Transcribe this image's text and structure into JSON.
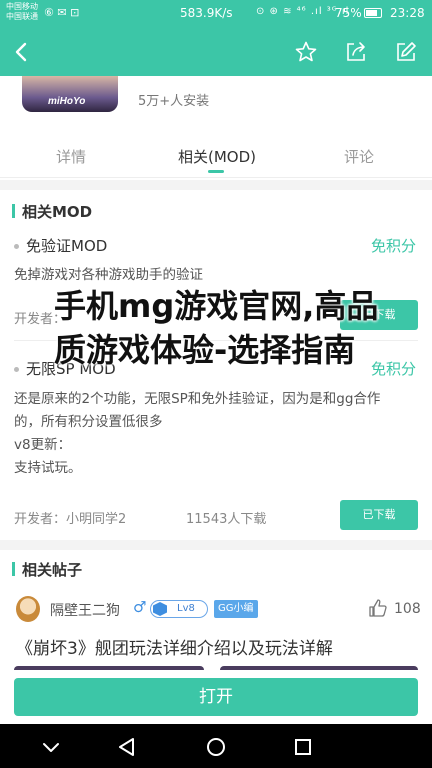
{
  "status_bar": {
    "carrier_line1": "中国移动",
    "carrier_line2": "中国联通",
    "left_icons": "⑥ ✉ ⊡",
    "net_speed": "583.9K/s",
    "right_icons": "⊙ ⊛ ≋ ⁴⁶ .ıl ³ᴳ.ıl",
    "battery": "75%",
    "time": "23:28"
  },
  "app_bar": {
    "back_icon": "back-arrow-icon",
    "actions": [
      "star-icon",
      "share-icon",
      "edit-icon"
    ]
  },
  "app_info": {
    "brand": "miHoYo",
    "install_count": "5万+人安装"
  },
  "tabs": [
    {
      "label": "详情",
      "active": false
    },
    {
      "label": "相关(MOD)",
      "active": true
    },
    {
      "label": "评论",
      "active": false
    }
  ],
  "mods_section": {
    "title": "相关MOD",
    "items": [
      {
        "name": "免验证MOD",
        "points": "免积分",
        "description": "免掉游戏对各种游戏助手的验证",
        "developer": "开发者：",
        "download_label": "已下载"
      },
      {
        "name": "无限SP MOD",
        "points": "免积分",
        "description_lines": [
          "还是原来的2个功能，无限SP和免外挂验证，因为是和gg合作",
          "的，所有积分设置低很多",
          "v8更新：",
          "支持试玩。"
        ],
        "developer": "开发者：小明同学2",
        "downloads": "11543人下载",
        "download_label": "已下载"
      }
    ]
  },
  "overlay_headline": "手机mg游戏官网,高品质游戏体验-选择指南",
  "posts_section": {
    "title": "相关帖子",
    "post": {
      "user": "隔壁王二狗",
      "gender_icon": "♂",
      "level": "Lv8",
      "badge": "GG小编",
      "likes": "108",
      "title": "《崩坏3》舰团玩法详细介绍以及玩法详解"
    }
  },
  "open_button": "打开",
  "colors": {
    "accent": "#3cc6a7",
    "badge_blue": "#5aa7ea",
    "text_dark": "#333333"
  },
  "nav_bar": [
    "nav-back-icon",
    "nav-home-icon",
    "nav-recents-icon"
  ]
}
